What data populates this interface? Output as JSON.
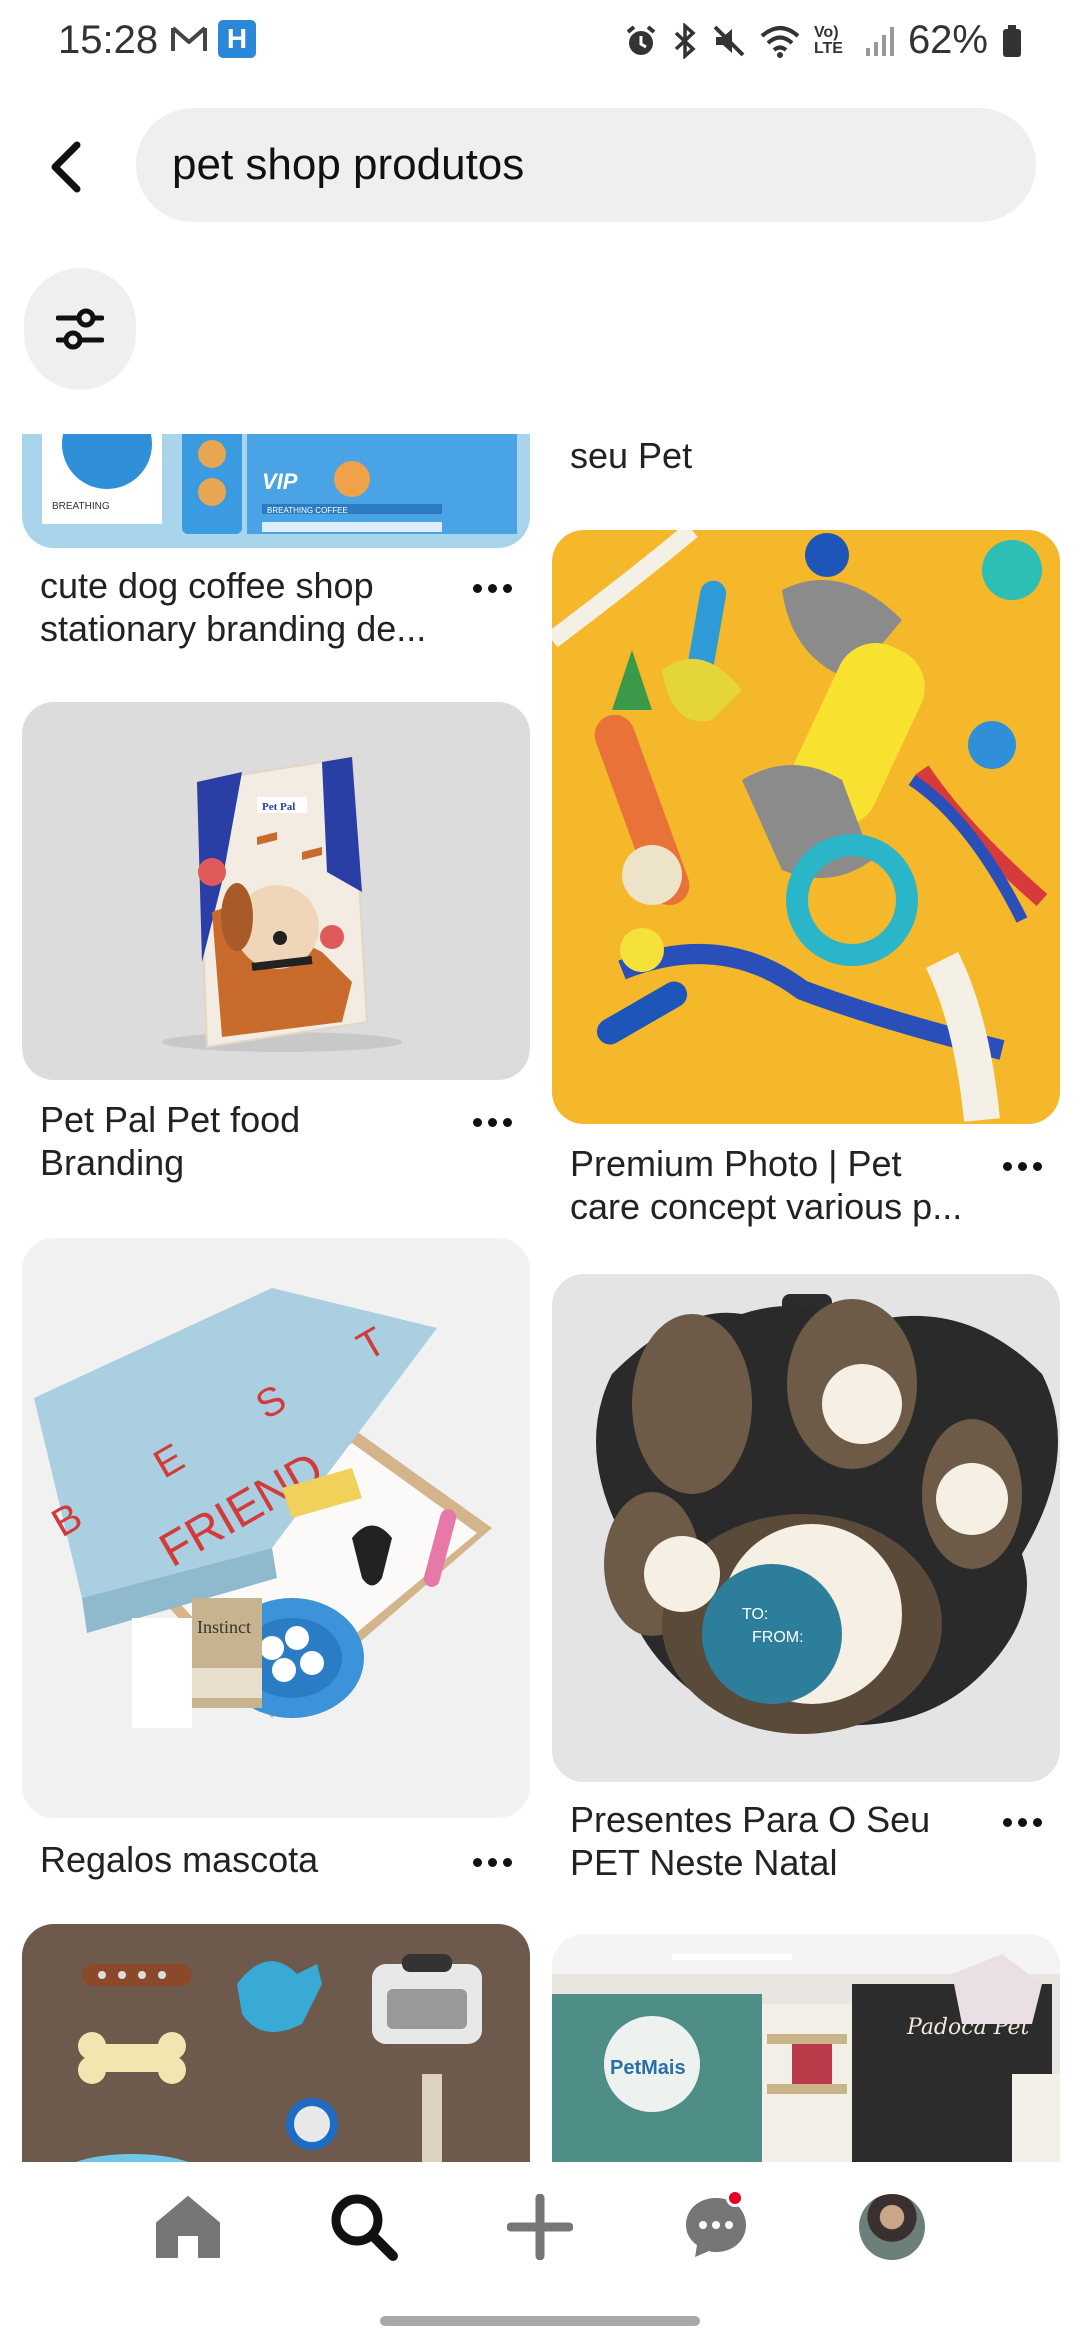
{
  "status_bar": {
    "time": "15:28",
    "battery": "62%",
    "left_icons": [
      "gmail-icon",
      "h-app-icon"
    ],
    "right_icons": [
      "alarm-icon",
      "bluetooth-icon",
      "mute-icon",
      "wifi-icon",
      "volte-icon",
      "signal-icon",
      "battery-icon"
    ],
    "volte_label": "Vo) LTE"
  },
  "header": {
    "search_value": "pet shop produtos"
  },
  "feed": {
    "pins": [
      {
        "id": "coffee",
        "title": "cute dog coffee shop stationary branding de...",
        "image_labels": [
          "VIP",
          "BREATHING COFFEE"
        ]
      },
      {
        "id": "petpal",
        "title": "Pet Pal Pet food Branding",
        "image_labels": [
          "Pet Pal"
        ]
      },
      {
        "id": "friend",
        "title": "Regalos mascota",
        "image_labels": [
          "B E S T",
          "FRIEND",
          "Instinct"
        ]
      },
      {
        "id": "petmais",
        "title": "",
        "image_labels": [
          "PetMais",
          "Padoca Pet"
        ]
      },
      {
        "id": "seupet",
        "title": "seu Pet",
        "image_labels": []
      },
      {
        "id": "toys",
        "title": "Premium Photo | Pet care concept various p...",
        "image_labels": []
      },
      {
        "id": "paw",
        "title": "Presentes Para O Seu PET Neste Natal",
        "image_labels": [
          "TO:",
          "FROM:"
        ]
      },
      {
        "id": "accessories",
        "title": "",
        "image_labels": []
      }
    ]
  },
  "bottom_nav": {
    "items": [
      "home-icon",
      "search-icon",
      "create-icon",
      "messages-icon",
      "profile-avatar"
    ]
  },
  "colors": {
    "accent": "#e60023",
    "search_bg": "#efefef",
    "toys_bg": "#f5b82a",
    "coffee_bg": "#a8d4ec",
    "friend_box": "#a9cfe0",
    "petmais_wall": "#4e8e86",
    "accessories_bg": "#6e5a4c"
  }
}
